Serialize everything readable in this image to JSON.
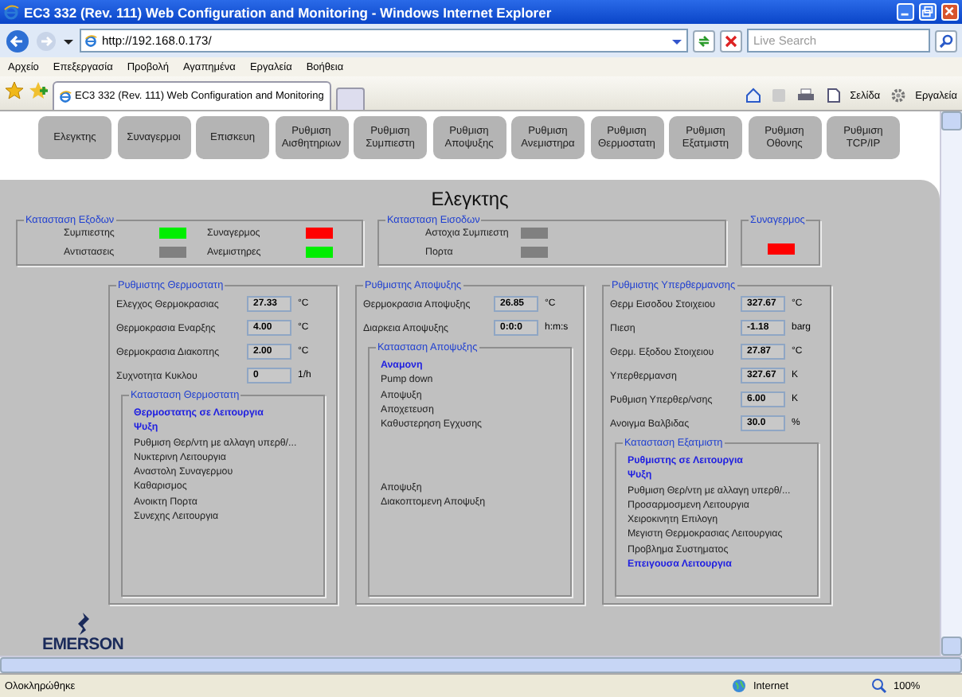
{
  "window": {
    "title": "EC3 332 (Rev. 111) Web Configuration and Monitoring - Windows Internet Explorer"
  },
  "address_bar": {
    "url": "http://192.168.0.173/"
  },
  "search": {
    "placeholder": "Live Search"
  },
  "menu": [
    "Αρχείο",
    "Επεξεργασία",
    "Προβολή",
    "Αγαπημένα",
    "Εργαλεία",
    "Βοήθεια"
  ],
  "tab": {
    "title": "EC3 332 (Rev. 111) Web Configuration and Monitoring"
  },
  "toolbar": {
    "page": "Σελίδα",
    "tools": "Εργαλεία"
  },
  "nav": [
    {
      "lines": [
        "Ελεγκτης"
      ]
    },
    {
      "lines": [
        "Συναγερμοι"
      ]
    },
    {
      "lines": [
        "Επισκευη"
      ]
    },
    {
      "lines": [
        "Ρυθμιση",
        "Αισθητηριων"
      ]
    },
    {
      "lines": [
        "Ρυθμιση",
        "Συμπιεστη"
      ]
    },
    {
      "lines": [
        "Ρυθμιση",
        "Αποψυξης"
      ]
    },
    {
      "lines": [
        "Ρυθμιση",
        "Ανεμιστηρα"
      ]
    },
    {
      "lines": [
        "Ρυθμιση",
        "Θερμοστατη"
      ]
    },
    {
      "lines": [
        "Ρυθμιση",
        "Εξατμιστη"
      ]
    },
    {
      "lines": [
        "Ρυθμιση",
        "Οθονης"
      ]
    },
    {
      "lines": [
        "Ρυθμιση",
        "TCP/IP"
      ]
    }
  ],
  "page_title": "Ελεγκτης",
  "outputs": {
    "legend": "Κατασταση Εξοδων",
    "items": [
      {
        "label": "Συμπιεστης",
        "color": "#00ee00"
      },
      {
        "label": "Συναγερμος",
        "color": "#ff0000"
      },
      {
        "label": "Αντιστασεις",
        "color": "#808080"
      },
      {
        "label": "Ανεμιστηρες",
        "color": "#00ee00"
      }
    ]
  },
  "inputs": {
    "legend": "Κατασταση Εισοδων",
    "items": [
      {
        "label": "Αστοχια Συμπιεστη",
        "color": "#808080"
      },
      {
        "label": "Πορτα",
        "color": "#808080"
      }
    ]
  },
  "alarm": {
    "legend": "Συναγερμος",
    "color": "#ff0000"
  },
  "columns": [
    {
      "legend": "Ρυθμιστης Θερμοστατη",
      "fields": [
        {
          "label": "Ελεγχος Θερμοκρασιας",
          "value": "27.33",
          "unit": "°C"
        },
        {
          "label": "Θερμοκρασια Εναρξης",
          "value": "4.00",
          "unit": "°C"
        },
        {
          "label": "Θερμοκρασια Διακοπης",
          "value": "2.00",
          "unit": "°C"
        },
        {
          "label": "Συχνοτητα Κυκλου",
          "value": "0",
          "unit": "1/h"
        }
      ],
      "status": {
        "legend": "Κατασταση Θερμοστατη",
        "groups": [
          [
            {
              "text": "Θερμοστατης σε Λειτουργια",
              "active": true
            },
            {
              "text": "Ψυξη",
              "active": true
            },
            {
              "text": "Ρυθμιση Θερ/ντη με αλλαγη υπερθ/...",
              "active": false
            },
            {
              "text": "Νυκτερινη Λειτουργια",
              "active": false
            },
            {
              "text": "Αναστολη Συναγερμου",
              "active": false
            },
            {
              "text": "Καθαρισμος",
              "active": false
            },
            {
              "text": "Ανοικτη Πορτα",
              "active": false
            },
            {
              "text": "Συνεχης Λειτουργια",
              "active": false
            }
          ]
        ]
      }
    },
    {
      "legend": "Ρυθμιστης Αποψυξης",
      "fields": [
        {
          "label": "Θερμοκρασια Αποψυξης",
          "value": "26.85",
          "unit": "°C"
        },
        {
          "label": "Διαρκεια Αποψυξης",
          "value": "0:0:0",
          "unit": "h:m:s"
        }
      ],
      "status": {
        "legend": "Κατασταση Αποψυξης",
        "groups": [
          [
            {
              "text": "Αναμονη",
              "active": true
            },
            {
              "text": "Pump down",
              "active": false
            },
            {
              "text": "Αποψυξη",
              "active": false
            },
            {
              "text": "Αποχετευση",
              "active": false
            },
            {
              "text": "Καθυστερηση Εγχυσης",
              "active": false
            }
          ],
          [
            {
              "text": "Αποψυξη",
              "active": false
            },
            {
              "text": "Διακοπτομενη Αποψυξη",
              "active": false
            }
          ]
        ]
      }
    },
    {
      "legend": "Ρυθμιστης Υπερθερμανσης",
      "fields": [
        {
          "label": "Θερμ Εισοδου Στοιχειου",
          "value": "327.67",
          "unit": "°C"
        },
        {
          "label": "Πιεση",
          "value": "-1.18",
          "unit": "barg"
        },
        {
          "label": "Θερμ. Εξοδου Στοιχειου",
          "value": "27.87",
          "unit": "°C"
        },
        {
          "label": "Υπερθερμανση",
          "value": "327.67",
          "unit": "K"
        },
        {
          "label": "Ρυθμιση Υπερθερ/νσης",
          "value": "6.00",
          "unit": "K"
        },
        {
          "label": "Ανοιγμα Βαλβιδας",
          "value": "30.0",
          "unit": "%"
        }
      ],
      "status": {
        "legend": "Κατασταση Εξατμιστη",
        "groups": [
          [
            {
              "text": "Ρυθμιστης σε Λειτουργια",
              "active": true
            },
            {
              "text": "Ψυξη",
              "active": true
            },
            {
              "text": "Ρυθμιση Θερ/ντη με αλλαγη υπερθ/...",
              "active": false
            },
            {
              "text": "Προσαρμοσμενη Λειτουργια",
              "active": false
            },
            {
              "text": "Χειροκινητη Επιλογη",
              "active": false
            },
            {
              "text": "Μεγιστη Θερμοκρασιας Λειτουργιας",
              "active": false
            },
            {
              "text": "Προβλημα Συστηματος",
              "active": false
            },
            {
              "text": "Επειγουσα Λειτουργια",
              "active": true
            }
          ]
        ]
      }
    }
  ],
  "logo": {
    "text": "EMERSON"
  },
  "status_bar": {
    "text": "Ολοκληρώθηκε",
    "zone": "Internet",
    "zoom": "100%"
  }
}
